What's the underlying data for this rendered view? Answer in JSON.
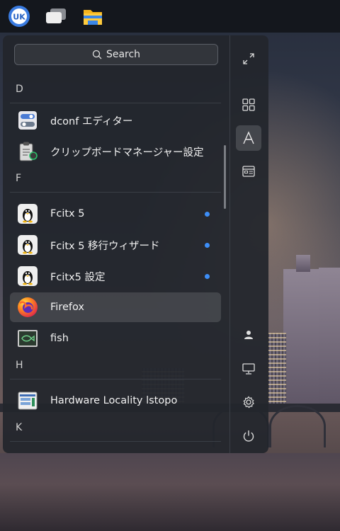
{
  "search": {
    "label": "Search"
  },
  "sections": [
    {
      "letter": "D",
      "items": [
        {
          "label": "dconf エディター",
          "icon": "dconf-editor-icon"
        },
        {
          "label": "クリップボードマネージャー設定",
          "icon": "clipboard-manager-icon"
        }
      ]
    },
    {
      "letter": "F",
      "items": [
        {
          "label": "Fcitx 5",
          "icon": "tux-penguin-icon",
          "new": true
        },
        {
          "label": "Fcitx 5 移行ウィザード",
          "icon": "tux-penguin-icon",
          "new": true
        },
        {
          "label": "Fcitx5 設定",
          "icon": "tux-penguin-icon",
          "new": true
        },
        {
          "label": "Firefox",
          "icon": "firefox-icon",
          "highlighted": true
        },
        {
          "label": "fish",
          "icon": "fish-terminal-icon"
        }
      ]
    },
    {
      "letter": "H",
      "items": [
        {
          "label": "Hardware Locality lstopo",
          "icon": "lstopo-icon"
        }
      ]
    },
    {
      "letter": "K",
      "items": []
    }
  ],
  "colors": {
    "accent_dot": "#3d8ef7",
    "panel_bg": "#22262c"
  }
}
